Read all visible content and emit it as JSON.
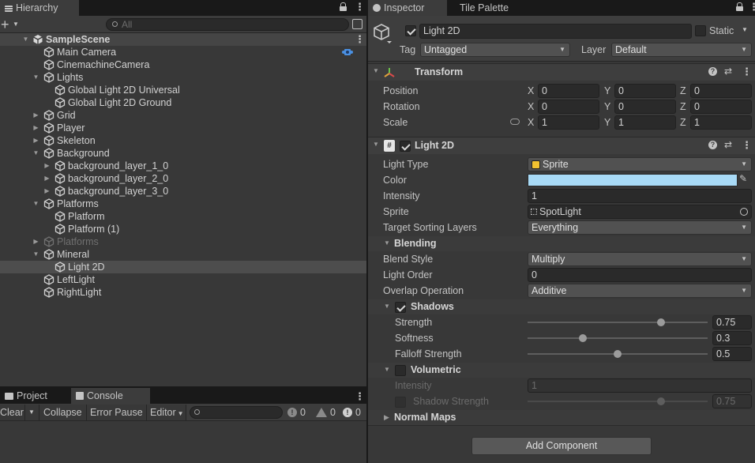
{
  "hierarchy": {
    "tab_label": "Hierarchy",
    "search_placeholder": "All",
    "rows": [
      {
        "label": "SampleScene",
        "depth": 0,
        "expand": "open",
        "kind": "scene"
      },
      {
        "label": "Main Camera",
        "depth": 1,
        "expand": "none",
        "kind": "go"
      },
      {
        "label": "CinemachineCamera",
        "depth": 1,
        "expand": "none",
        "kind": "go"
      },
      {
        "label": "Lights",
        "depth": 1,
        "expand": "open",
        "kind": "go"
      },
      {
        "label": "Global Light 2D Universal",
        "depth": 2,
        "expand": "none",
        "kind": "go"
      },
      {
        "label": "Global Light 2D Ground",
        "depth": 2,
        "expand": "none",
        "kind": "go"
      },
      {
        "label": "Grid",
        "depth": 1,
        "expand": "closed",
        "kind": "go"
      },
      {
        "label": "Player",
        "depth": 1,
        "expand": "closed",
        "kind": "go"
      },
      {
        "label": "Skeleton",
        "depth": 1,
        "expand": "closed",
        "kind": "go"
      },
      {
        "label": "Background",
        "depth": 1,
        "expand": "open",
        "kind": "go"
      },
      {
        "label": "background_layer_1_0",
        "depth": 2,
        "expand": "closed",
        "kind": "go"
      },
      {
        "label": "background_layer_2_0",
        "depth": 2,
        "expand": "closed",
        "kind": "go"
      },
      {
        "label": "background_layer_3_0",
        "depth": 2,
        "expand": "closed",
        "kind": "go"
      },
      {
        "label": "Platforms",
        "depth": 1,
        "expand": "open",
        "kind": "go"
      },
      {
        "label": "Platform",
        "depth": 2,
        "expand": "none",
        "kind": "go"
      },
      {
        "label": "Platform (1)",
        "depth": 2,
        "expand": "none",
        "kind": "go"
      },
      {
        "label": "Platforms",
        "depth": 1,
        "expand": "closed",
        "kind": "go",
        "dim": true
      },
      {
        "label": "Mineral",
        "depth": 1,
        "expand": "open",
        "kind": "go"
      },
      {
        "label": "Light 2D",
        "depth": 2,
        "expand": "none",
        "kind": "go",
        "selected": true
      },
      {
        "label": "LeftLight",
        "depth": 1,
        "expand": "none",
        "kind": "go"
      },
      {
        "label": "RightLight",
        "depth": 1,
        "expand": "none",
        "kind": "go"
      }
    ]
  },
  "bottom": {
    "tabs": [
      "Project",
      "Console"
    ],
    "toolbar": {
      "clear": "Clear",
      "collapse": "Collapse",
      "error_pause": "Error Pause",
      "editor": "Editor"
    },
    "counts": {
      "info": "0",
      "warning": "0",
      "error": "0"
    }
  },
  "inspector": {
    "tabs": [
      "Inspector",
      "Tile Palette"
    ],
    "object_name": "Light 2D",
    "active_checked": true,
    "static_label": "Static",
    "static_checked": false,
    "tag_label": "Tag",
    "tag_value": "Untagged",
    "layer_label": "Layer",
    "layer_value": "Default",
    "transform": {
      "title": "Transform",
      "rows": [
        {
          "label": "Position",
          "x": "0",
          "y": "0",
          "z": "0"
        },
        {
          "label": "Rotation",
          "x": "0",
          "y": "0",
          "z": "0"
        },
        {
          "label": "Scale",
          "x": "1",
          "y": "1",
          "z": "1"
        }
      ],
      "axis": {
        "x": "X",
        "y": "Y",
        "z": "Z"
      }
    },
    "light2d": {
      "title": "Light 2D",
      "enabled": true,
      "light_type_label": "Light Type",
      "light_type_value": "Sprite",
      "color_label": "Color",
      "color_value": "#a8daf6",
      "intensity_label": "Intensity",
      "intensity_value": "1",
      "sprite_label": "Sprite",
      "sprite_value": "SpotLight",
      "tsl_label": "Target Sorting Layers",
      "tsl_value": "Everything",
      "blending": {
        "title": "Blending",
        "blend_style_label": "Blend Style",
        "blend_style_value": "Multiply",
        "light_order_label": "Light Order",
        "light_order_value": "0",
        "overlap_label": "Overlap Operation",
        "overlap_value": "Additive"
      },
      "shadows": {
        "title": "Shadows",
        "enabled": true,
        "strength_label": "Strength",
        "strength_value": "0.75",
        "strength_level": 0.75,
        "softness_label": "Softness",
        "softness_value": "0.3",
        "softness_level": 0.3,
        "falloff_label": "Falloff Strength",
        "falloff_value": "0.5",
        "falloff_level": 0.5
      },
      "volumetric": {
        "title": "Volumetric",
        "enabled": false,
        "intensity_label": "Intensity",
        "intensity_value": "1",
        "shadow_strength_label": "Shadow Strength",
        "shadow_strength_value": "0.75",
        "shadow_strength_level": 0.75
      },
      "normal_maps_title": "Normal Maps"
    },
    "add_component": "Add Component"
  }
}
